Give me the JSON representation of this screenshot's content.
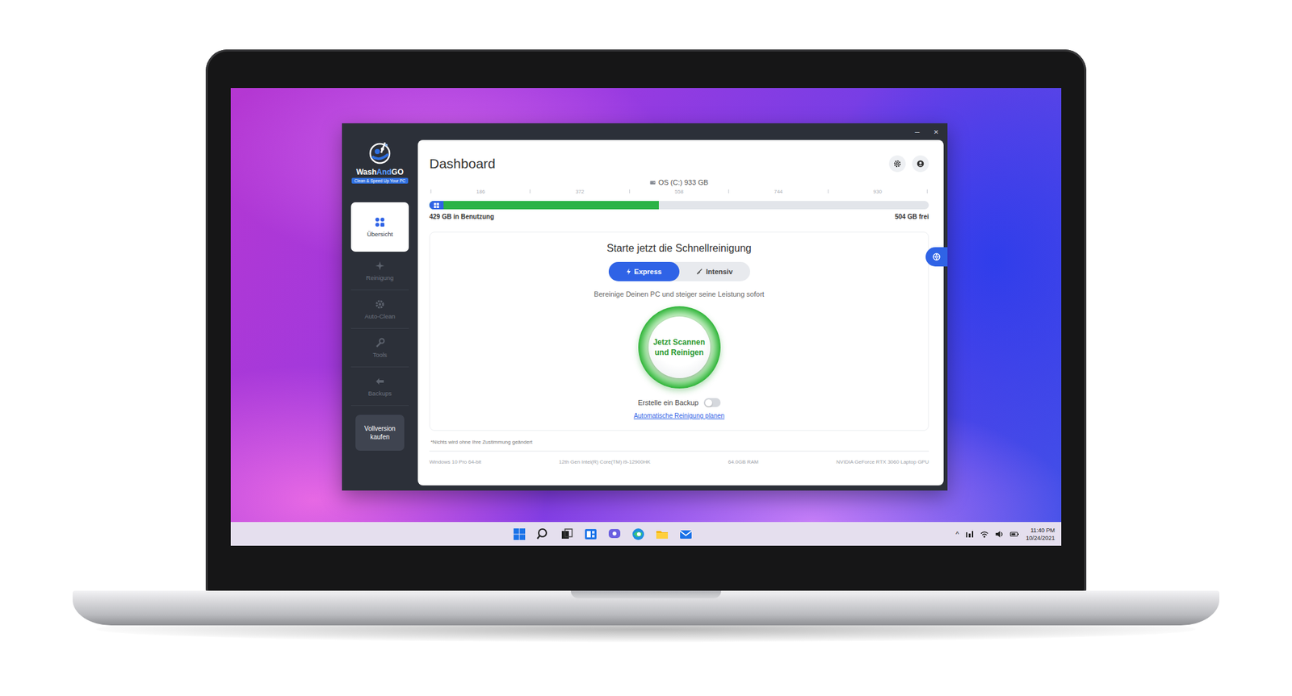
{
  "app": {
    "window_controls": [
      "–",
      "×"
    ],
    "logo": {
      "parts": [
        "Wash",
        "And",
        "GO"
      ],
      "tagline": "Clean & Speed Up Your PC"
    },
    "sidebar": {
      "items": [
        {
          "label": "Übersicht",
          "selected": true
        },
        {
          "label": "Reinigung",
          "selected": false
        },
        {
          "label": "Auto-Clean",
          "selected": false
        },
        {
          "label": "Tools",
          "selected": false
        },
        {
          "label": "Backups",
          "selected": false
        }
      ],
      "buy_button": "Vollversion kaufen"
    },
    "header": {
      "title": "Dashboard"
    },
    "disk": {
      "label": "OS (C:) 933 GB",
      "ticks": [
        "186",
        "372",
        "558",
        "744",
        "930"
      ],
      "level": 0.46,
      "used": "429 GB in Benutzung",
      "free": "504 GB frei"
    },
    "quick_clean": {
      "title": "Starte jetzt die Schnellreinigung",
      "modes": [
        {
          "label": "Express",
          "selected": true
        },
        {
          "label": "Intensiv",
          "selected": false
        }
      ],
      "description": "Bereinige Deinen PC und steiger seine Leistung sofort",
      "scan_button": "Jetzt Scannen und Reinigen",
      "backup": {
        "label": "Erstelle ein Backup",
        "on": false
      },
      "schedule_link": "Automatische Reinigung planen"
    },
    "footnote": "*Nichts wird ohne Ihre Zustimmung geändert",
    "specs": [
      "Windows 10 Pro 64-bit",
      "12th Gen Intel(R) Core(TM) i9-12900HK",
      "64.0GB RAM",
      "NVIDIA GeForce RTX 3060 Laptop GPU"
    ]
  },
  "taskbar": {
    "tray_arrow": "^",
    "time": "11:40 PM",
    "date": "10/24/2021"
  }
}
